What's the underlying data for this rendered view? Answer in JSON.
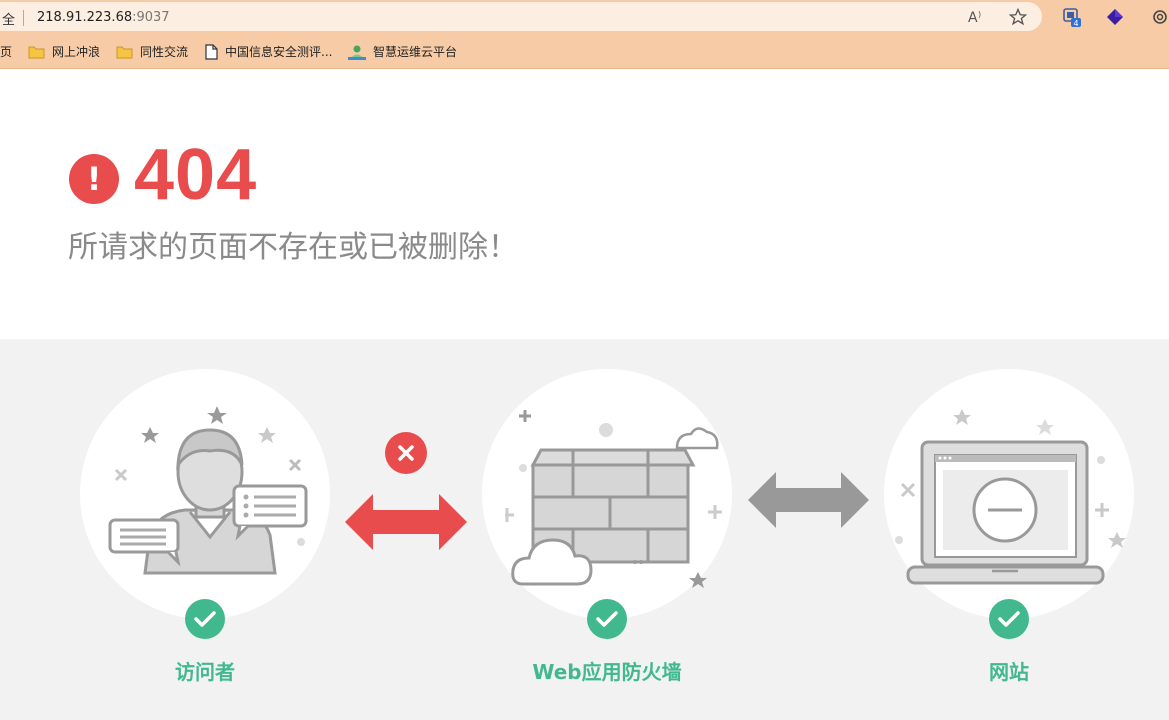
{
  "browser": {
    "left_fragment": "全",
    "url_host": "218.91.223.68",
    "url_port": ":9037",
    "extension_badge": "4"
  },
  "bookmarks": [
    {
      "fragment": "页"
    },
    {
      "label": "网上冲浪",
      "icon": "folder-icon"
    },
    {
      "label": "同性交流",
      "icon": "folder-icon"
    },
    {
      "label": "中国信息安全测评...",
      "icon": "page-icon"
    },
    {
      "label": "智慧运维云平台",
      "icon": "site-icon"
    }
  ],
  "error": {
    "code": "404",
    "badge": "!",
    "message": "所请求的页面不存在或已被删除！"
  },
  "nodes": [
    {
      "label": "访问者",
      "icon": "visitor-icon"
    },
    {
      "label": "Web应用防火墙",
      "icon": "firewall-icon"
    },
    {
      "label": "网站",
      "icon": "website-icon"
    }
  ],
  "colors": {
    "error_red": "#e84c4c",
    "success_green": "#41b88e",
    "neutral_gray": "#999999",
    "chrome_orange": "#f6cba5"
  }
}
